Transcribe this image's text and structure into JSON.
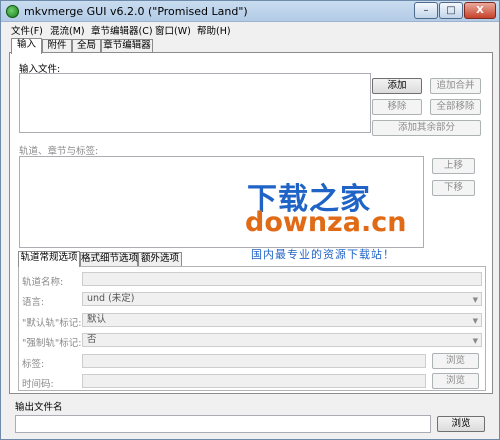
{
  "window": {
    "title": "mkvmerge GUI v6.2.0 (\"Promised Land\")",
    "min": "–",
    "max": "□",
    "close": "X"
  },
  "menu": [
    "文件(F)",
    "混流(M)",
    "章节编辑器(C)",
    "窗口(W)",
    "帮助(H)"
  ],
  "tabs": [
    "输入",
    "附件",
    "全局",
    "章节编辑器"
  ],
  "input": {
    "files_label": "输入文件:",
    "add": "添加",
    "append": "追加合并",
    "remove": "移除",
    "remove_all": "全部移除",
    "add_other": "添加其余部分",
    "tracks_label": "轨道、章节与标签:",
    "up": "上移",
    "down": "下移"
  },
  "subtabs": [
    "轨道常规选项",
    "格式细节选项",
    "额外选项"
  ],
  "general": {
    "track_name_label": "轨道名称:",
    "language_label": "语言:",
    "language_value": "und (未定)",
    "default_label": "\"默认轨\"标记:",
    "default_value": "默认",
    "forced_label": "\"强制轨\"标记:",
    "forced_value": "否",
    "tags_label": "标签:",
    "tags_browse": "浏览",
    "timecodes_label": "时间码:",
    "timecodes_browse": "浏览"
  },
  "output": {
    "label": "输出文件名",
    "browse": "浏览"
  },
  "watermark": {
    "brand": "下载之家",
    "url": "downza.cn",
    "slogan": "国内最专业的资源下载站！"
  },
  "colors": {
    "titlebar": "#c3d6ec",
    "watermark_blue": "#1f63c7",
    "watermark_orange": "#e06a16"
  }
}
